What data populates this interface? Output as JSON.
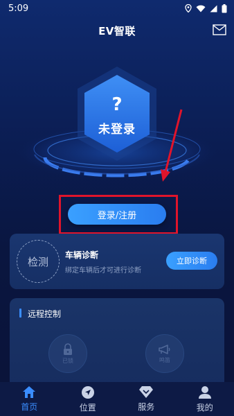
{
  "status_bar": {
    "time": "5:09",
    "icons": [
      "location-icon",
      "wifi-icon",
      "signal-icon",
      "battery-icon"
    ]
  },
  "header": {
    "title": "EV智联",
    "mail_icon": "mail-icon"
  },
  "hero": {
    "question_mark": "?",
    "login_state": "未登录"
  },
  "login": {
    "button_label": "登录/注册"
  },
  "diagnosis": {
    "circle_label": "检测",
    "title": "车辆诊断",
    "subtitle": "绑定车辆后才可进行诊断",
    "button_label": "立即诊断"
  },
  "remote": {
    "title": "远程控制",
    "controls": [
      {
        "icon": "lock-icon",
        "label": "已锁"
      },
      {
        "icon": "horn-icon",
        "label": "鸣笛"
      }
    ]
  },
  "bottom_nav": {
    "items": [
      {
        "label": "首页",
        "icon": "home-icon",
        "active": true
      },
      {
        "label": "位置",
        "icon": "location-arrow-icon",
        "active": false
      },
      {
        "label": "服务",
        "icon": "diamond-icon",
        "active": false
      },
      {
        "label": "我的",
        "icon": "user-icon",
        "active": false
      }
    ]
  },
  "colors": {
    "accent": "#3a8dff",
    "annotation_red": "#e0142b",
    "background": "#0b1d52"
  }
}
